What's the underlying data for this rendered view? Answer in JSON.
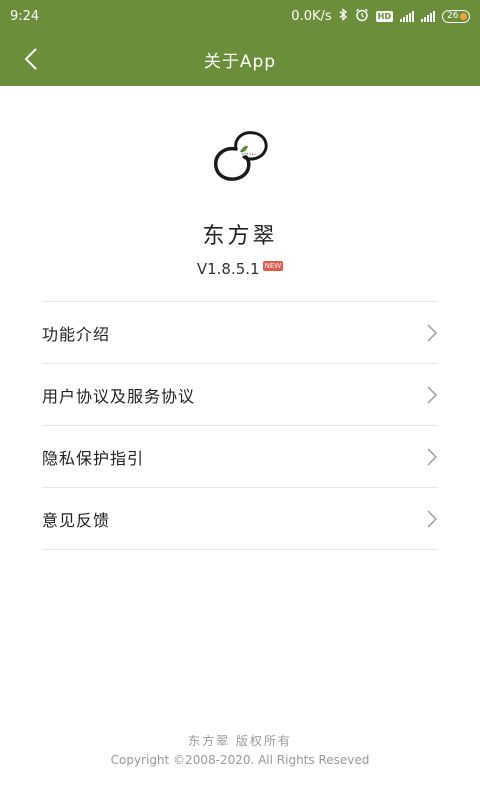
{
  "status_bar": {
    "time": "9:24",
    "net_speed": "0.0K/s",
    "icons": [
      "bluetooth-icon",
      "alarm-icon",
      "hd-icon",
      "4g-signal-icon",
      "signal-icon"
    ],
    "hd_label": "HD",
    "battery": "26",
    "colors": {
      "background": "#6b8e3a",
      "battery_dot": "#f2a13a"
    }
  },
  "header": {
    "title": "关于App",
    "back_icon": "chevron-left-icon"
  },
  "app": {
    "logo_icon": "brand-logo-icon",
    "name": "东方翠",
    "version": "V1.8.5.1",
    "new_badge": "NEW"
  },
  "menu": {
    "items": [
      {
        "label": "功能介绍"
      },
      {
        "label": "用户协议及服务协议"
      },
      {
        "label": "隐私保护指引"
      },
      {
        "label": "意见反馈"
      }
    ],
    "chevron_icon": "chevron-right-icon"
  },
  "footer": {
    "owner": "东方翠 版权所有",
    "copyright": "Copyright ©2008-2020. All Rights Reseved"
  },
  "colors": {
    "accent": "#6b8e3a",
    "badge": "#e55a4a"
  }
}
